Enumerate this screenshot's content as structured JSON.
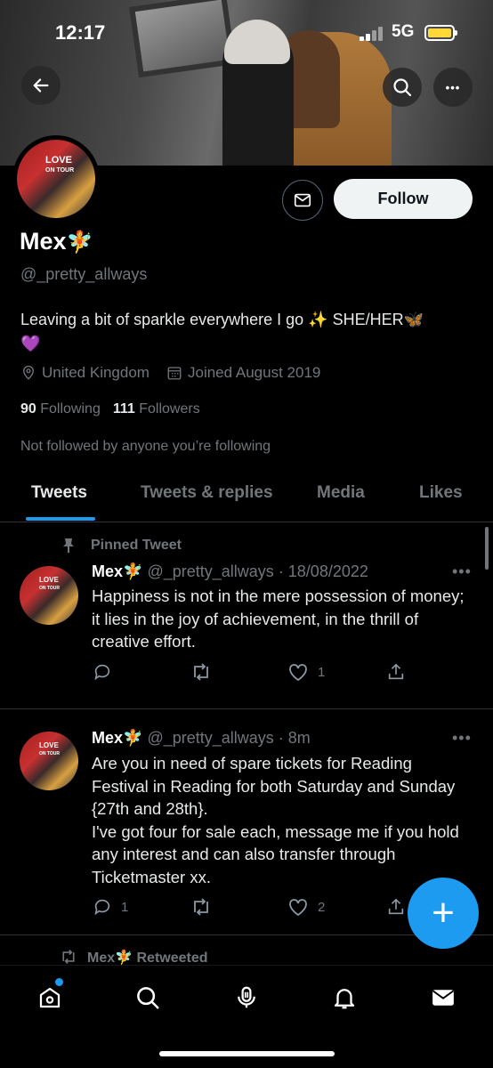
{
  "status": {
    "time": "12:17",
    "network": "5G"
  },
  "profile": {
    "name": "Mex",
    "name_emoji": "🧚",
    "handle": "@_pretty_allways",
    "bio_line1": "Leaving a bit of sparkle everywhere I go ✨ SHE/HER🦋",
    "bio_line2": "💜",
    "location": "United Kingdom",
    "joined": "Joined August 2019",
    "following_count": "90",
    "following_label": "Following",
    "followers_count": "111",
    "followers_label": "Followers",
    "not_followed": "Not followed by anyone you’re following",
    "follow_label": "Follow",
    "avatar_text1": "LOVE",
    "avatar_text2": "ON TOUR"
  },
  "tabs": [
    "Tweets",
    "Tweets & replies",
    "Media",
    "Likes"
  ],
  "pinned_label": "Pinned Tweet",
  "tweets": [
    {
      "name": "Mex",
      "emoji": "🧚",
      "meta": "@_pretty_allways · 18/08/2022",
      "text": "Happiness is not in the mere possession of money; it lies in the joy of achievement, in the thrill of creative effort.",
      "replies": "",
      "retweets": "",
      "likes": "1"
    },
    {
      "name": "Mex",
      "emoji": "🧚",
      "meta": "@_pretty_allways · 8m",
      "text": "Are you in need of spare tickets for Reading Festival in Reading for both Saturday and Sunday {27th and 28th}.\nI've got four for sale each, message me if you hold any interest and can also transfer through Ticketmaster xx.",
      "replies": "1",
      "retweets": "",
      "likes": "2"
    }
  ],
  "retweeted": {
    "name": "Mex",
    "emoji": "🧚",
    "label": "Retweeted"
  },
  "more_glyph": "•••",
  "fab_glyph": "+",
  "colors": {
    "accent": "#1d9bf0",
    "background": "#000000",
    "muted": "#71767b"
  }
}
